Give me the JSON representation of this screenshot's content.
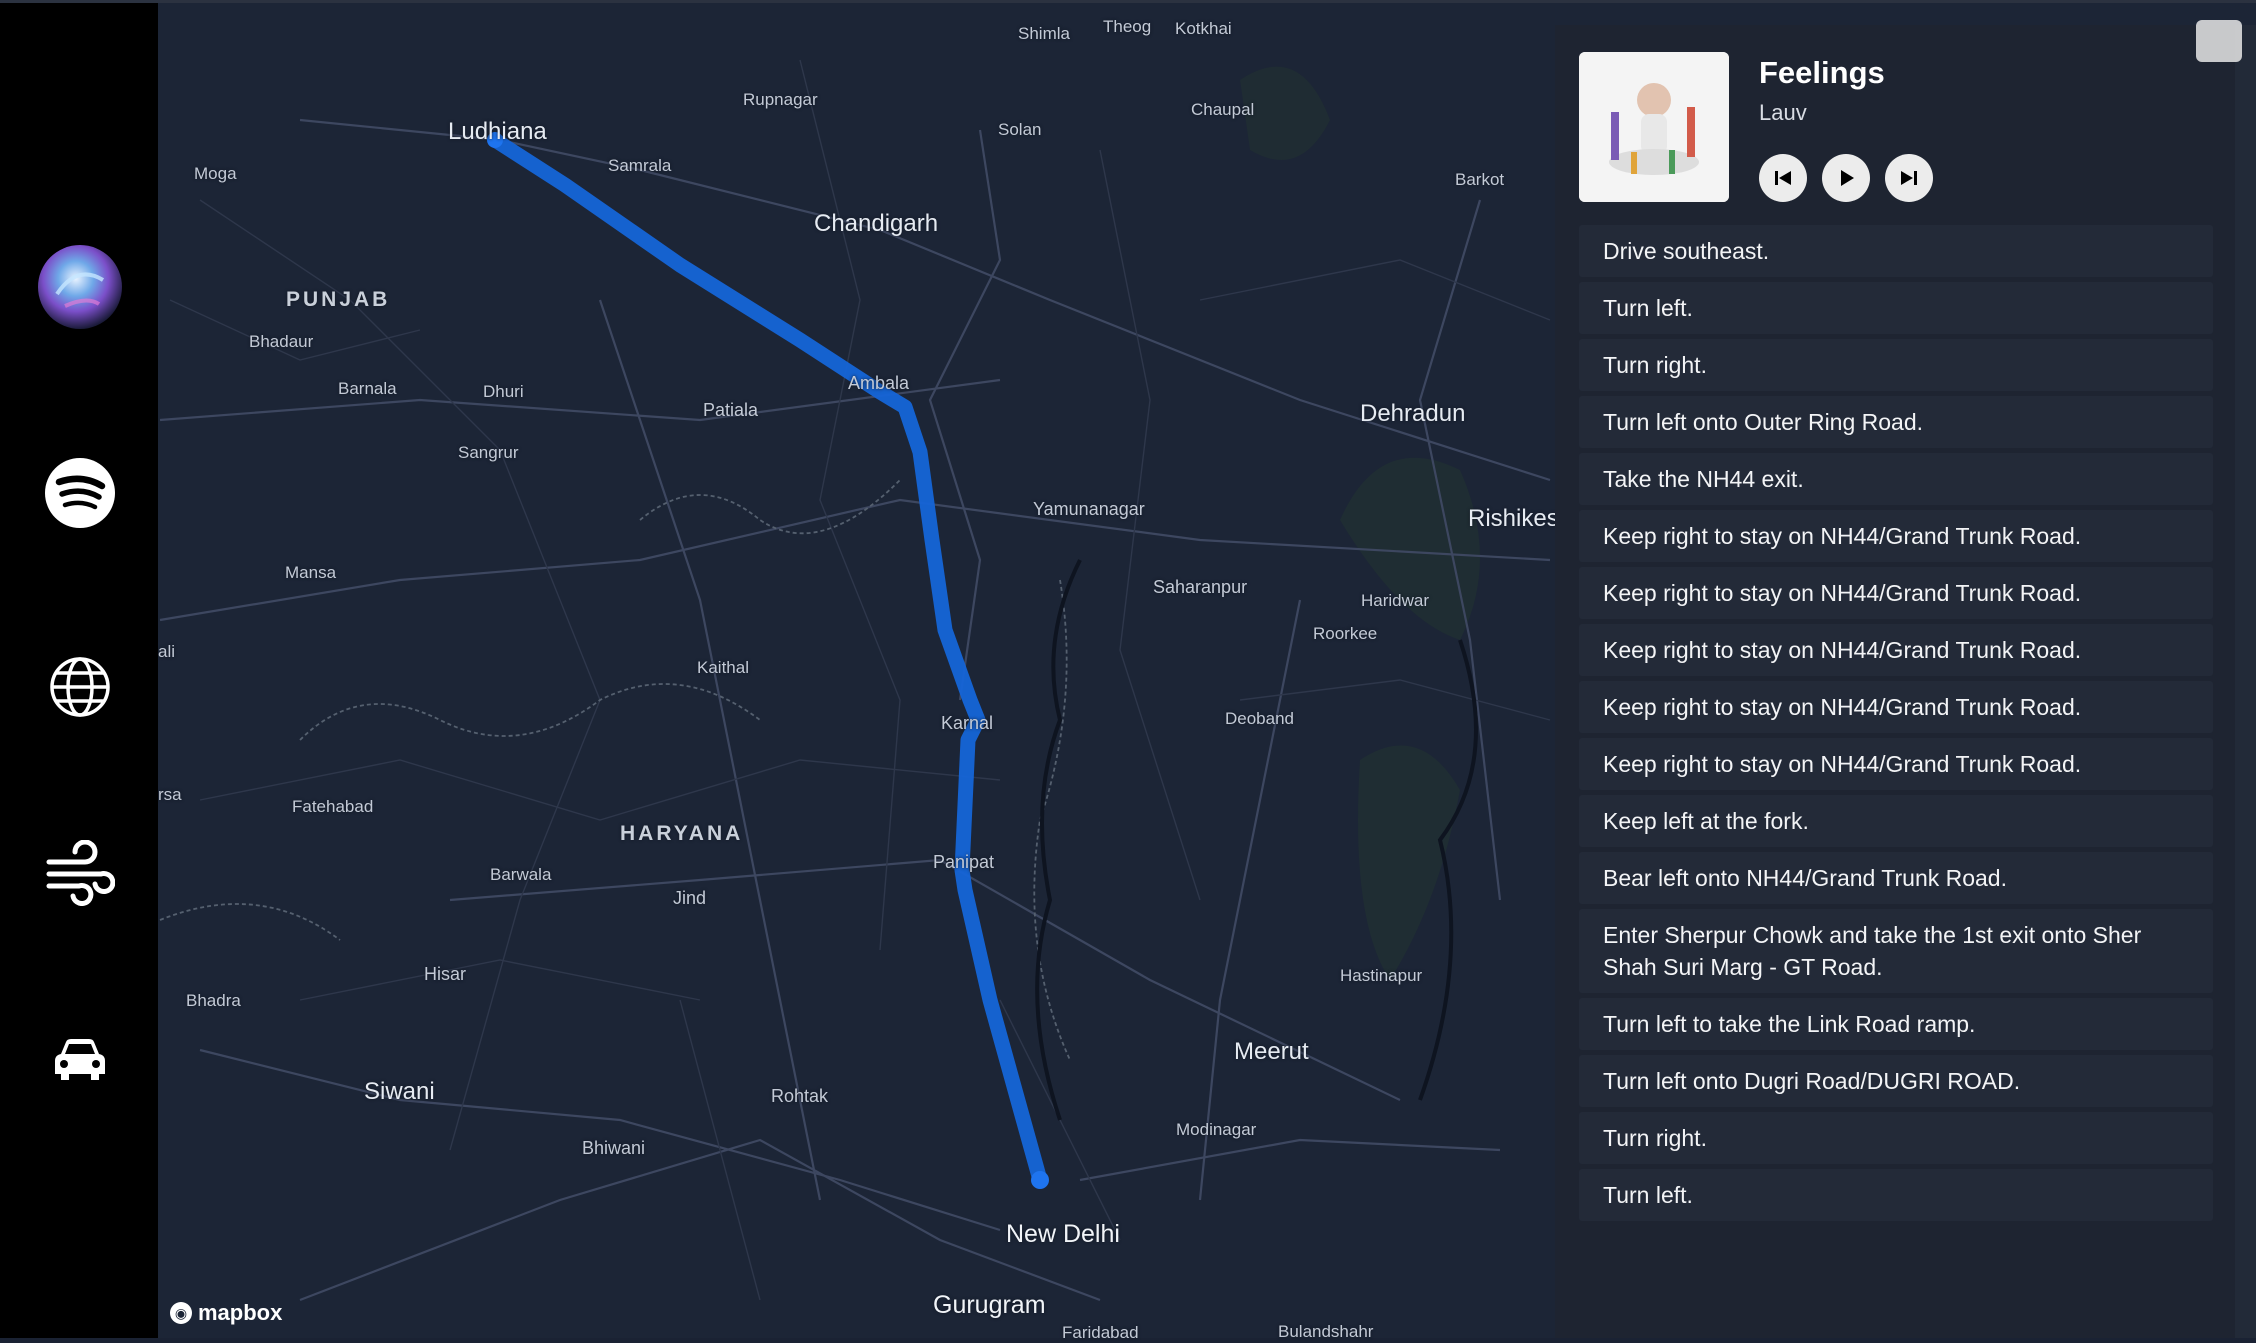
{
  "sidebar": {
    "items": [
      {
        "name": "assistant",
        "icon": "siri-orb-icon"
      },
      {
        "name": "spotify",
        "icon": "spotify-icon"
      },
      {
        "name": "browser",
        "icon": "globe-icon"
      },
      {
        "name": "climate",
        "icon": "wind-icon"
      },
      {
        "name": "car",
        "icon": "car-icon"
      }
    ]
  },
  "map": {
    "attribution": "mapbox",
    "route_color": "#1565d8",
    "labels": {
      "shimla": "Shimla",
      "theog": "Theog",
      "kotkhai": "Kotkhai",
      "rupnagar": "Rupnagar",
      "ludhiana": "Ludhiana",
      "samrala": "Samrala",
      "moga": "Moga",
      "solan": "Solan",
      "chaupal": "Chaupal",
      "barkot": "Barkot",
      "chandigarh": "Chandigarh",
      "punjab": "PUNJAB",
      "bhadaur": "Bhadaur",
      "barnala": "Barnala",
      "dhuri": "Dhuri",
      "ambala": "Ambala",
      "patiala": "Patiala",
      "sangrur": "Sangrur",
      "dehradun": "Dehradun",
      "rishikesh": "Rishikes",
      "yamunanagar": "Yamunanagar",
      "mansa": "Mansa",
      "saharanpur": "Saharanpur",
      "haridwar": "Haridwar",
      "roorkee": "Roorkee",
      "ali": "ali",
      "kaithal": "Kaithal",
      "karnal": "Karnal",
      "deoband": "Deoband",
      "sa": "rsa",
      "fatehabad": "Fatehabad",
      "haryana": "HARYANA",
      "panipat": "Panipat",
      "barwala": "Barwala",
      "jind": "Jind",
      "hastinapur": "Hastinapur",
      "bhadra": "Bhadra",
      "hisar": "Hisar",
      "meerut": "Meerut",
      "siwani": "Siwani",
      "rohtak": "Rohtak",
      "modinagar": "Modinagar",
      "bhiwani": "Bhiwani",
      "newdelhi": "New Delhi",
      "gurugram": "Gurugram",
      "faridabad": "Faridabad",
      "bulandshahr": "Bulandshahr"
    }
  },
  "player": {
    "title": "Feelings",
    "artist": "Lauv",
    "controls": {
      "prev": "skip-previous-icon",
      "play": "play-icon",
      "next": "skip-next-icon"
    }
  },
  "directions": [
    "Drive southeast.",
    "Turn left.",
    "Turn right.",
    "Turn left onto Outer Ring Road.",
    "Take the NH44 exit.",
    "Keep right to stay on NH44/Grand Trunk Road.",
    "Keep right to stay on NH44/Grand Trunk Road.",
    "Keep right to stay on NH44/Grand Trunk Road.",
    "Keep right to stay on NH44/Grand Trunk Road.",
    "Keep right to stay on NH44/Grand Trunk Road.",
    "Keep left at the fork.",
    "Bear left onto NH44/Grand Trunk Road.",
    "Enter Sherpur Chowk and take the 1st exit onto Sher Shah Suri Marg - GT Road.",
    "Turn left to take the Link Road ramp.",
    "Turn left onto Dugri Road/DUGRI ROAD.",
    "Turn right.",
    "Turn left."
  ]
}
